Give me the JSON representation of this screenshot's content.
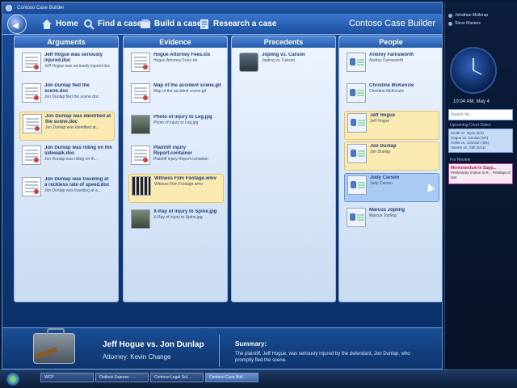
{
  "window": {
    "title": "Contoso Case Builder",
    "app_title": "Contoso Case Builder"
  },
  "nav": {
    "home": "Home",
    "find": "Find a case",
    "build": "Build a case",
    "research": "Research a case"
  },
  "columns": {
    "arguments": {
      "header": "Arguments",
      "items": [
        {
          "title": "Jeff Hogue was seriously injured.doc",
          "sub": "Jeff Hogue was seriously injured.doc",
          "icon": "document-icon"
        },
        {
          "title": "Jon Dunlap fled the scene.doc",
          "sub": "Jon Dunlap fled the scene.doc",
          "icon": "document-icon"
        },
        {
          "title": "Jon Dunlap was identified at the scene.doc",
          "sub": "Jon Dunlap was identified at...",
          "icon": "document-icon",
          "selected": true
        },
        {
          "title": "Jon Dunlap was riding on the sidewalk.doc",
          "sub": "Jon Dunlap was riding on th...",
          "icon": "document-icon"
        },
        {
          "title": "Jon Dunlap was traveling at a reckless rate of speed.doc",
          "sub": "Jon Dunlap was traveling at a...",
          "icon": "document-icon"
        }
      ]
    },
    "evidence": {
      "header": "Evidence",
      "items": [
        {
          "title": "Hogue Attorney Fees.xls",
          "sub": "Hogue Attorney Fees.xls",
          "icon": "spreadsheet-icon"
        },
        {
          "title": "Map of the accident scene.gif",
          "sub": "Map of the accident scene.gif",
          "icon": "map-icon"
        },
        {
          "title": "Photo of injury to Leg.jpg",
          "sub": "Photo of injury to Leg.jpg",
          "icon": "photo-icon"
        },
        {
          "title": "Plaintiff injury Report.container",
          "sub": "Plaintiff injury Report.container",
          "icon": "document-icon"
        },
        {
          "title": "Witness Film Footage.wmv",
          "sub": "Witness Film Footage.wmv",
          "icon": "film-icon",
          "selected": true
        },
        {
          "title": "X-Ray of injury to Spine.jpg",
          "sub": "X-Ray of injury to Spine.jpg",
          "icon": "photo-icon"
        }
      ]
    },
    "precedents": {
      "header": "Precedents",
      "items": [
        {
          "title": "Jopling vs. Carson",
          "sub": "Jopling vs. Carson",
          "icon": "briefcase-icon"
        }
      ]
    },
    "people": {
      "header": "People",
      "items": [
        {
          "title": "Andrey Farnsworth",
          "sub": "Andrey Farnsworth",
          "icon": "contact-card-icon"
        },
        {
          "title": "Christine McKenzie",
          "sub": "Christine McKenzie",
          "icon": "contact-card-icon"
        },
        {
          "title": "Jeff Hogue",
          "sub": "Jeff Hogue",
          "icon": "contact-card-icon",
          "selected": true
        },
        {
          "title": "Jon Dunlap",
          "sub": "Jon Dunlap",
          "icon": "contact-card-icon",
          "selected": true
        },
        {
          "title": "Judy Carson",
          "sub": "Judy Carson",
          "icon": "contact-card-icon",
          "hover": true
        },
        {
          "title": "Marcus Jopling",
          "sub": "Marcus Jopling",
          "icon": "contact-card-icon"
        }
      ]
    }
  },
  "details": {
    "case_title": "Jeff Hogue vs. Jon Dunlap",
    "attorney": "Attorney: Kevin Change",
    "summary_label": "Summary:",
    "summary_text": "The plaintiff, Jeff Hogue, was seriously injured by the defendant, Jon Dunlap, who promptly fled the scene."
  },
  "sidebar": {
    "users": [
      "Johathan Mollerup",
      "Steve Masters"
    ],
    "clock_text": "10:04 AM, May 4",
    "search_placeholder": "Search for...",
    "court_label": "Upcoming Court Dates",
    "court_dates": [
      "Smith vs. Ryan (5/4)",
      "Hogue vs. Dunlap (5/4)",
      "Hollet vs. Johnson (5/5)",
      "Sarven vs. Gilb (5/11)"
    ],
    "review_label": "For Review",
    "review_title": "Memorandum in Supp...",
    "review_text": "Preliminary motion to R... Findings of fact"
  },
  "taskbar": {
    "tasks": [
      "WCP",
      "Outlook Express - ...",
      "Contoso Legal Sol...",
      "Contoso Case Buil..."
    ]
  },
  "colors": {
    "accent": "#255aa8",
    "selected_bg": "#fbe9b2",
    "hover_bg": "#a9cbf3"
  }
}
